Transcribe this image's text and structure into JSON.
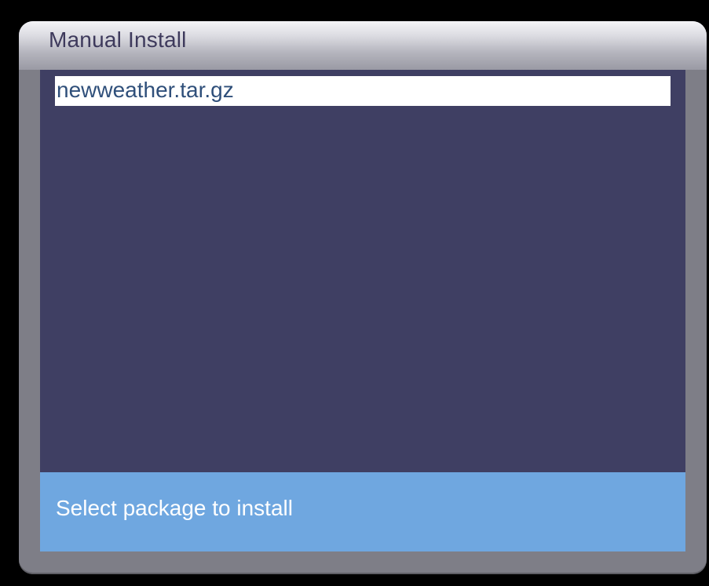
{
  "dialog": {
    "title": "Manual Install"
  },
  "package_list": {
    "items": [
      {
        "label": "newweather.tar.gz",
        "selected": true
      }
    ]
  },
  "status": {
    "message": "Select package to install"
  },
  "colors": {
    "background": "#000000",
    "frame": "#7e7e87",
    "title_text": "#3e3a5c",
    "list_background": "#3f3f63",
    "selected_item_background": "#ffffff",
    "selected_item_text": "#2f4f7a",
    "status_background": "#6fa7e0",
    "status_text": "#ffffff"
  }
}
